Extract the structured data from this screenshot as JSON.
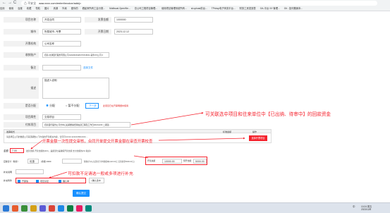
{
  "browser": {
    "back": "←",
    "forward": "→",
    "reload": "C",
    "info_icon": "⚠ 不安全",
    "url": "aaa.xxxx.com/enter/invoice/add/p"
  },
  "bookmarks": [
    "应用",
    "使用",
    "百度",
    "收藏",
    "导航",
    "图片",
    "资源",
    "外卖",
    "爱你的",
    "看起来所有工会分类...",
    "Multisoal.OpenWe...",
    "总公司工程项目管理...",
    "使用项目管理系统所有...",
    "al-upload前台...",
    "TPshop电子商务平台...",
    "财务工资发放表",
    "OA-平台 XX 管理...",
    "Git - 如何撤销本..."
  ],
  "form": {
    "row1": {
      "label": "项目名称",
      "value": "开发合同",
      "label2": "发票金额",
      "value2": "1000000"
    },
    "row2": {
      "label": "城市",
      "value": "所属城市--专票",
      "label2": "开票日期",
      "value2": "2023-12-12"
    },
    "row3": {
      "label": "开票机构",
      "value": "公司名称"
    },
    "row4": {
      "label": "收款账户",
      "value": "招商-交通银行股份有限公司-6222620420471516011-蒙牛XX公司 2"
    },
    "row5": {
      "label": "备注",
      "value": "",
      "link": "选择文件"
    },
    "row6": {
      "label": "描述",
      "value": "描述人说明"
    },
    "row7": {
      "label": "是否分配",
      "opt1": "分配",
      "opt2": "暂不分配",
      "next_btn": "下一步",
      "hint": "此项目已在开票明细中使用"
    },
    "row8": {
      "label": "项目属性",
      "value": "交易项目"
    },
    "row9": {
      "label": "付款项目",
      "value": "招商银行股份公司分中心后期整备费用在建工程及工作日2021/2/20 二期第..."
    }
  },
  "table": {
    "h1": "发票模式",
    "h2": "标准金额",
    "h3": "操作",
    "row_text": "请选择应公司的数据公司来源期数以下内容的开票相关内容，合同号10310-3202108010001 ...",
    "row_btn": "选择开票项目",
    "amount_label": "金额",
    "amount_value": "7.00",
    "amount_note": "发票金额-开票金额的30%，差额部分是确保开票金额 支付金额的2% 税点0",
    "tax_label": "应税合计（税金）",
    "tax_val1": "优惠",
    "tax_mid": "(金额) 6000",
    "tax_note": "税收(计价)占实际合计内容据本(1110.00元 实际资金5090.00元)",
    "total_label": "开票总额",
    "total_val": "10000.00",
    "rate_label": "预开金额：",
    "rate_val": "5000.00",
    "remark_label": "补充说明",
    "remark_value": "",
    "attach_label": "补充附件",
    "attach1": "开票信",
    "attach2": "项目交接",
    "attach3": "确认单",
    "attach_btn": "+确认选中"
  },
  "submit": "确认提交",
  "annotations": {
    "a1": "可关联选中项目和往来单位中【已出纳、待审中】的回款资金",
    "a2": "开票金额一次性提交审核，合同开单提交开票金额在审查开票校查",
    "a3": "可扣款不足请选一般或多项进行补充"
  },
  "taskbar": {
    "time": "10:24 周五",
    "date": "2023/12/8",
    "lang": "中"
  },
  "colors": {
    "accent": "#1890ff",
    "warn": "#f5222d",
    "label_bg": "#f2f2f2"
  }
}
